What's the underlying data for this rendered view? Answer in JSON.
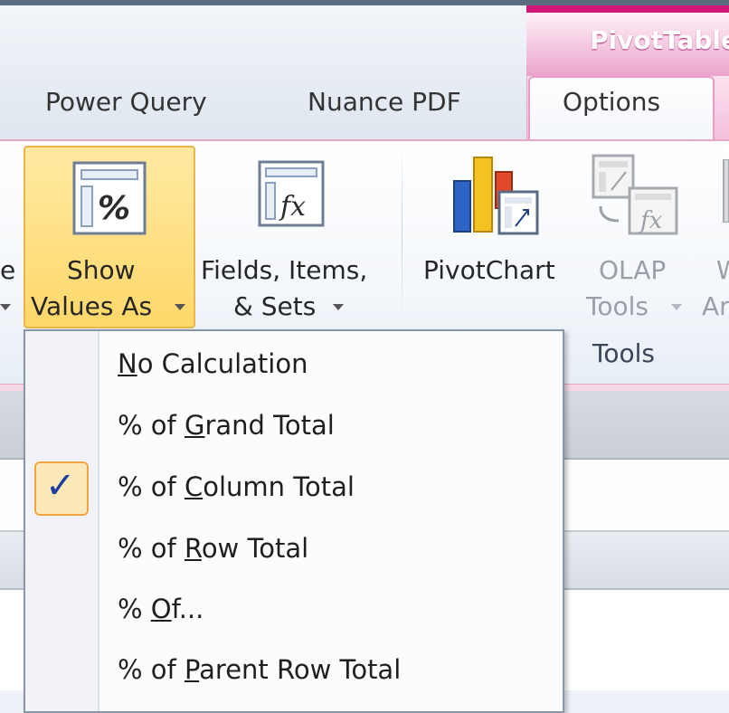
{
  "tabs": {
    "contextual_label": "PivotTable",
    "power_query": "Power Query",
    "nuance_pdf": "Nuance PDF",
    "options": "Options"
  },
  "ribbon": {
    "partial_left_label": "e",
    "show_values_as": {
      "line1": "Show",
      "line2": "Values As"
    },
    "fields_items_sets": {
      "line1": "Fields, Items,",
      "line2": "& Sets"
    },
    "pivotchart": "PivotChart",
    "olap_tools": {
      "line1": "OLAP",
      "line2": "Tools"
    },
    "partial_right": {
      "line1": "W",
      "line2": "Ar"
    },
    "group_tools": "Tools"
  },
  "menu": {
    "items": [
      {
        "pre": "",
        "u": "N",
        "post": "o Calculation"
      },
      {
        "pre": "% of ",
        "u": "G",
        "post": "rand Total"
      },
      {
        "pre": "% of ",
        "u": "C",
        "post": "olumn Total",
        "checked": true
      },
      {
        "pre": "% of ",
        "u": "R",
        "post": "ow Total"
      },
      {
        "pre": "% ",
        "u": "O",
        "post": "f..."
      },
      {
        "pre": "% of ",
        "u": "P",
        "post": "arent Row Total"
      }
    ],
    "check_mark": "✓"
  },
  "colors": {
    "accent_pink": "#d0167a",
    "active_button": "#ffd86a",
    "check_blue": "#1b3fa0"
  }
}
